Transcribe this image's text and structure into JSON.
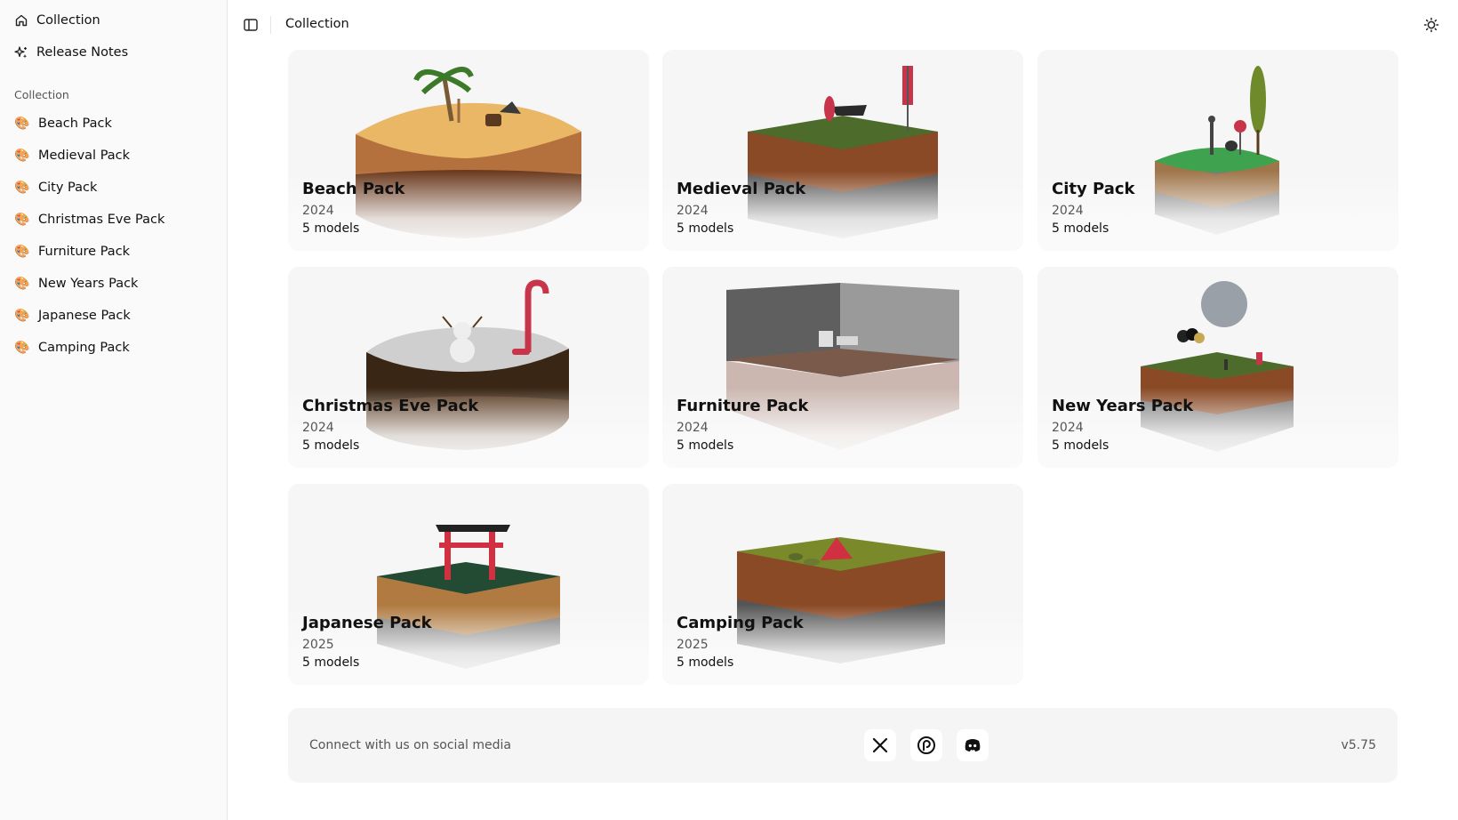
{
  "sidebar": {
    "nav": [
      {
        "label": "Collection",
        "icon": "home-icon"
      },
      {
        "label": "Release Notes",
        "icon": "sparkles-icon"
      }
    ],
    "group_label": "Collection",
    "packs": [
      {
        "label": "Beach Pack",
        "icon": "palette-icon"
      },
      {
        "label": "Medieval Pack",
        "icon": "palette-icon"
      },
      {
        "label": "City Pack",
        "icon": "palette-icon"
      },
      {
        "label": "Christmas Eve Pack",
        "icon": "palette-icon"
      },
      {
        "label": "Furniture Pack",
        "icon": "palette-icon"
      },
      {
        "label": "New Years Pack",
        "icon": "palette-icon"
      },
      {
        "label": "Japanese Pack",
        "icon": "palette-icon"
      },
      {
        "label": "Camping Pack",
        "icon": "palette-icon"
      }
    ]
  },
  "header": {
    "title": "Collection",
    "toggle_icon": "sidebar-toggle-icon",
    "theme_icon": "sun-icon"
  },
  "cards": [
    {
      "title": "Beach Pack",
      "year": "2024",
      "count": "5 models"
    },
    {
      "title": "Medieval Pack",
      "year": "2024",
      "count": "5 models"
    },
    {
      "title": "City Pack",
      "year": "2024",
      "count": "5 models"
    },
    {
      "title": "Christmas Eve Pack",
      "year": "2024",
      "count": "5 models"
    },
    {
      "title": "Furniture Pack",
      "year": "2024",
      "count": "5 models"
    },
    {
      "title": "New Years Pack",
      "year": "2024",
      "count": "5 models"
    },
    {
      "title": "Japanese Pack",
      "year": "2025",
      "count": "5 models"
    },
    {
      "title": "Camping Pack",
      "year": "2025",
      "count": "5 models"
    }
  ],
  "footer": {
    "connect": "Connect with us on social media",
    "version": "v5.75",
    "social": [
      "x-icon",
      "patreon-icon",
      "discord-icon"
    ]
  }
}
